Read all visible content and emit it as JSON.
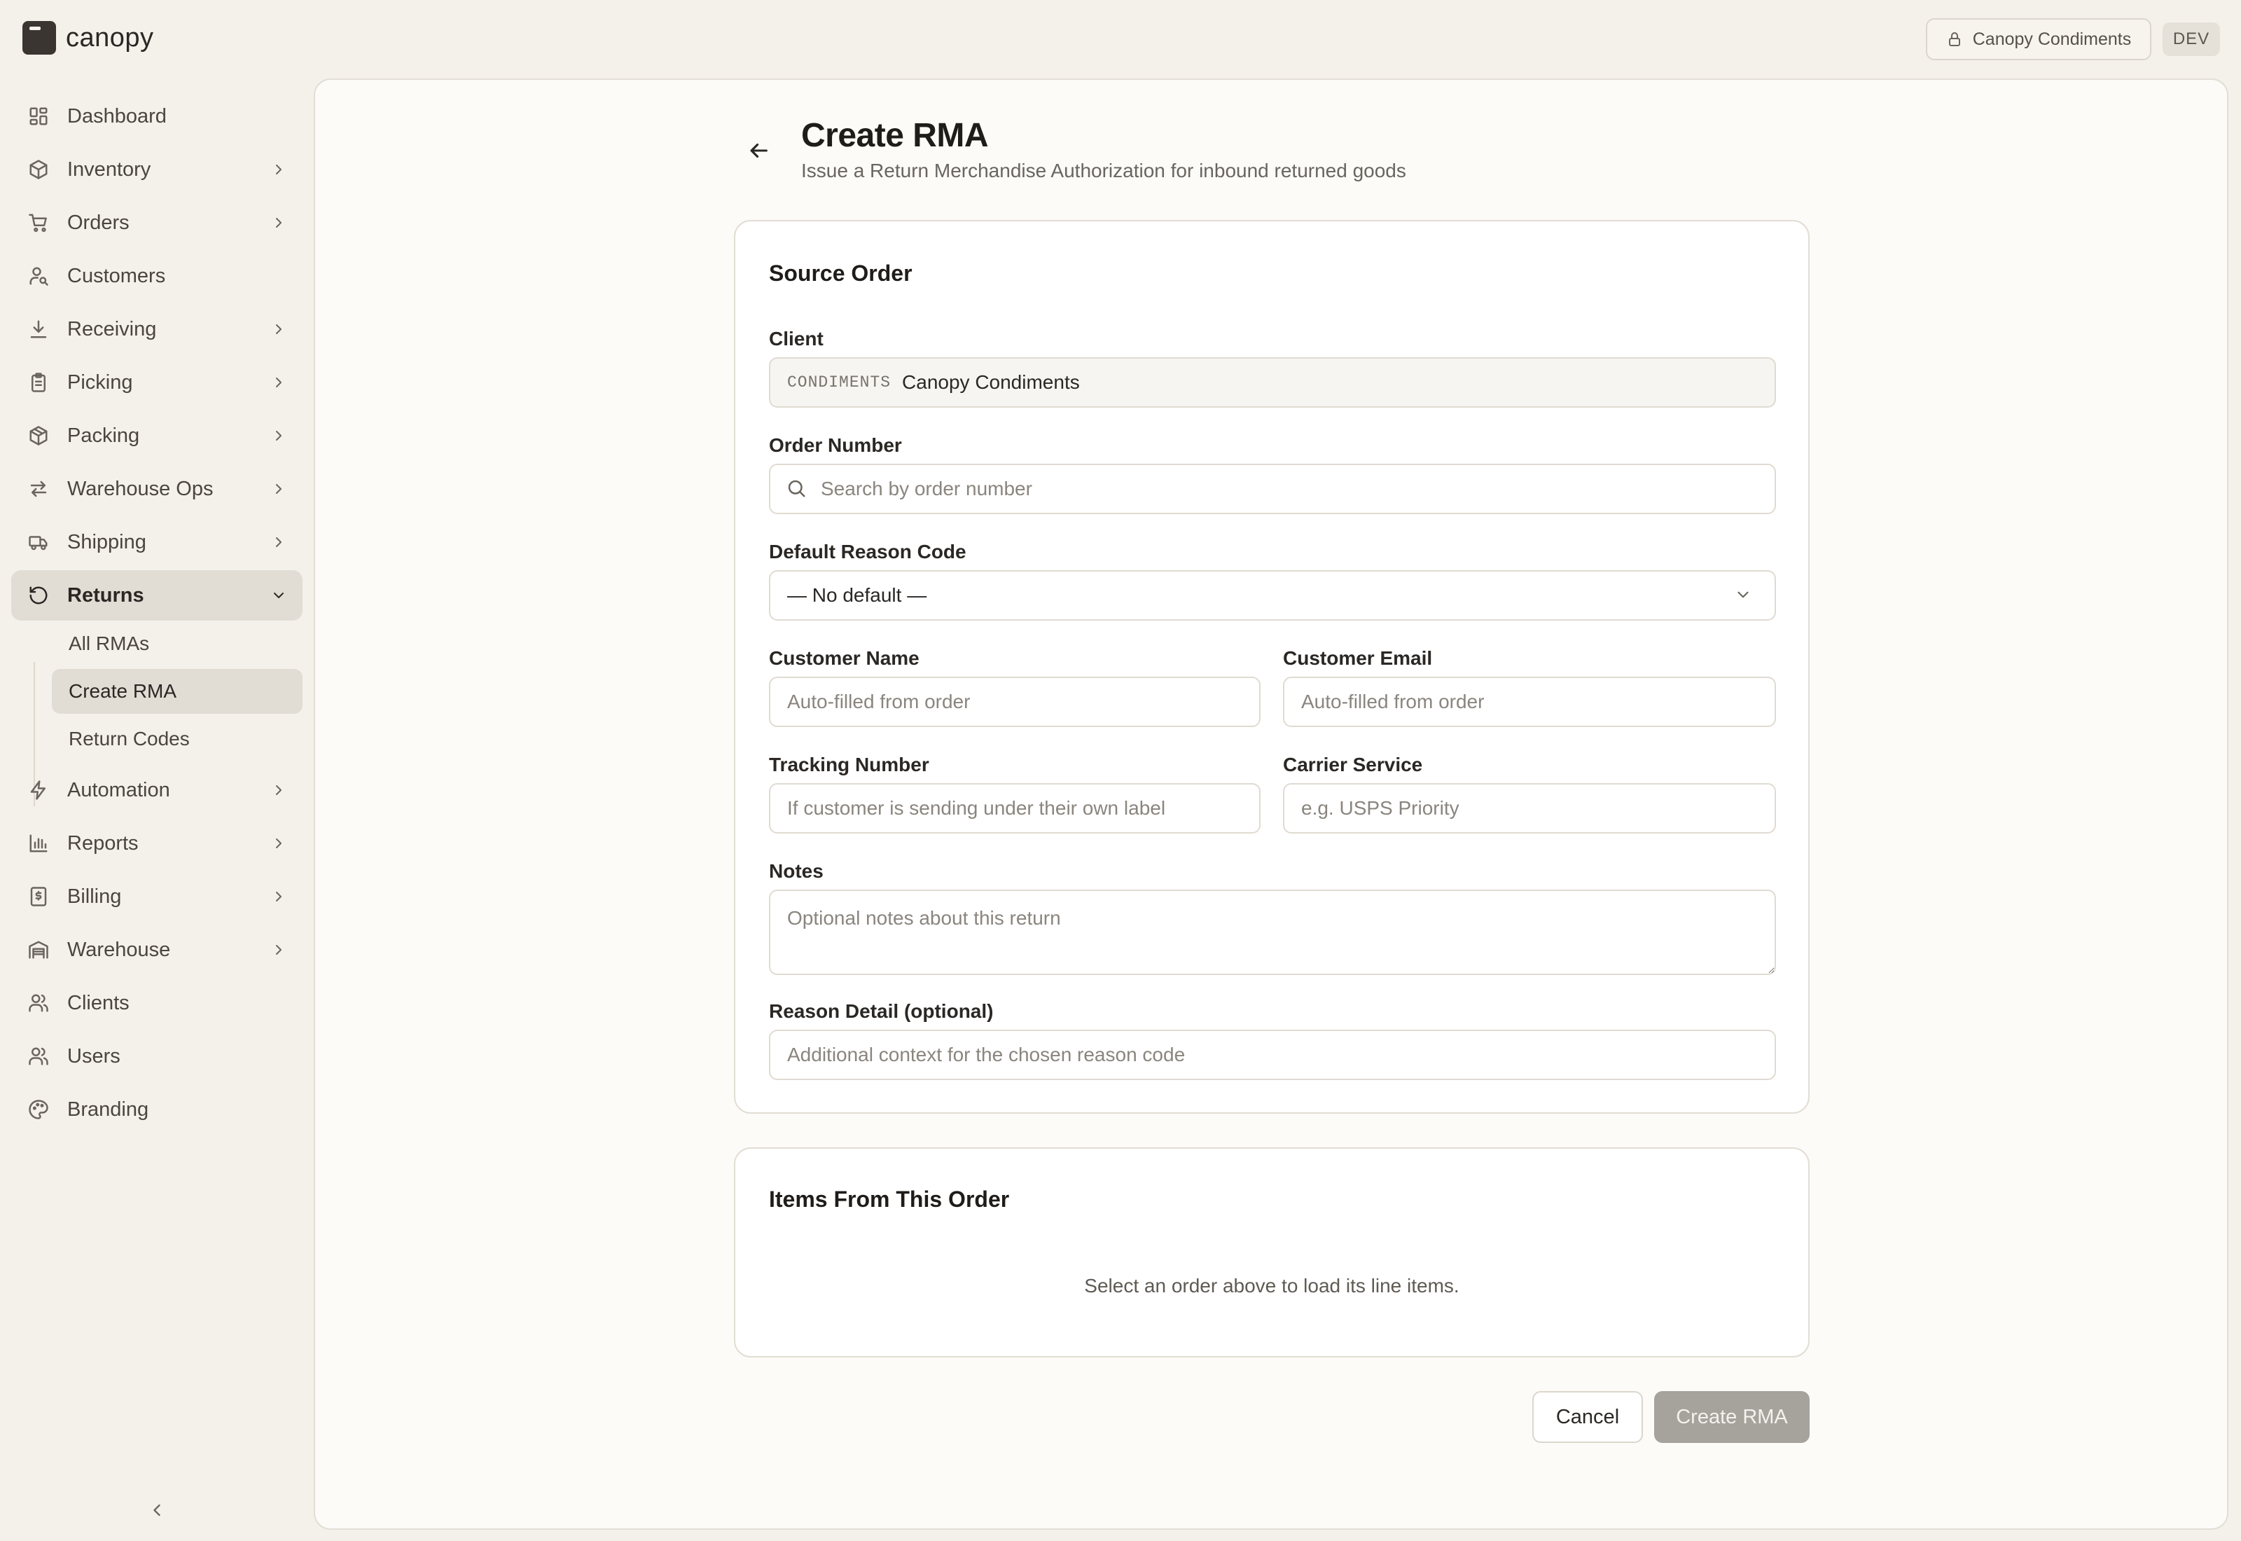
{
  "app": {
    "brand": "canopy",
    "tenant": "Canopy Condiments",
    "env": "DEV"
  },
  "sidebar": {
    "items": [
      {
        "label": "Dashboard"
      },
      {
        "label": "Inventory"
      },
      {
        "label": "Orders"
      },
      {
        "label": "Customers"
      },
      {
        "label": "Receiving"
      },
      {
        "label": "Picking"
      },
      {
        "label": "Packing"
      },
      {
        "label": "Warehouse Ops"
      },
      {
        "label": "Shipping"
      },
      {
        "label": "Returns"
      },
      {
        "label": "Automation"
      },
      {
        "label": "Reports"
      },
      {
        "label": "Billing"
      },
      {
        "label": "Warehouse"
      },
      {
        "label": "Clients"
      },
      {
        "label": "Users"
      },
      {
        "label": "Branding"
      }
    ],
    "returns_sub": [
      {
        "label": "All RMAs"
      },
      {
        "label": "Create RMA"
      },
      {
        "label": "Return Codes"
      }
    ]
  },
  "page": {
    "title": "Create RMA",
    "subtitle": "Issue a Return Merchandise Authorization for inbound returned goods"
  },
  "source_order": {
    "title": "Source Order",
    "client_label": "Client",
    "client_code": "CONDIMENTS",
    "client_name": "Canopy Condiments",
    "order_number_label": "Order Number",
    "order_number_placeholder": "Search by order number",
    "reason_code_label": "Default Reason Code",
    "reason_code_value": "— No default —",
    "customer_name_label": "Customer Name",
    "customer_name_placeholder": "Auto-filled from order",
    "customer_email_label": "Customer Email",
    "customer_email_placeholder": "Auto-filled from order",
    "tracking_label": "Tracking Number",
    "tracking_placeholder": "If customer is sending under their own label",
    "carrier_label": "Carrier Service",
    "carrier_placeholder": "e.g. USPS Priority",
    "notes_label": "Notes",
    "notes_placeholder": "Optional notes about this return",
    "reason_detail_label": "Reason Detail (optional)",
    "reason_detail_placeholder": "Additional context for the chosen reason code"
  },
  "items": {
    "title": "Items From This Order",
    "empty": "Select an order above to load its line items."
  },
  "actions": {
    "cancel": "Cancel",
    "create": "Create RMA"
  }
}
